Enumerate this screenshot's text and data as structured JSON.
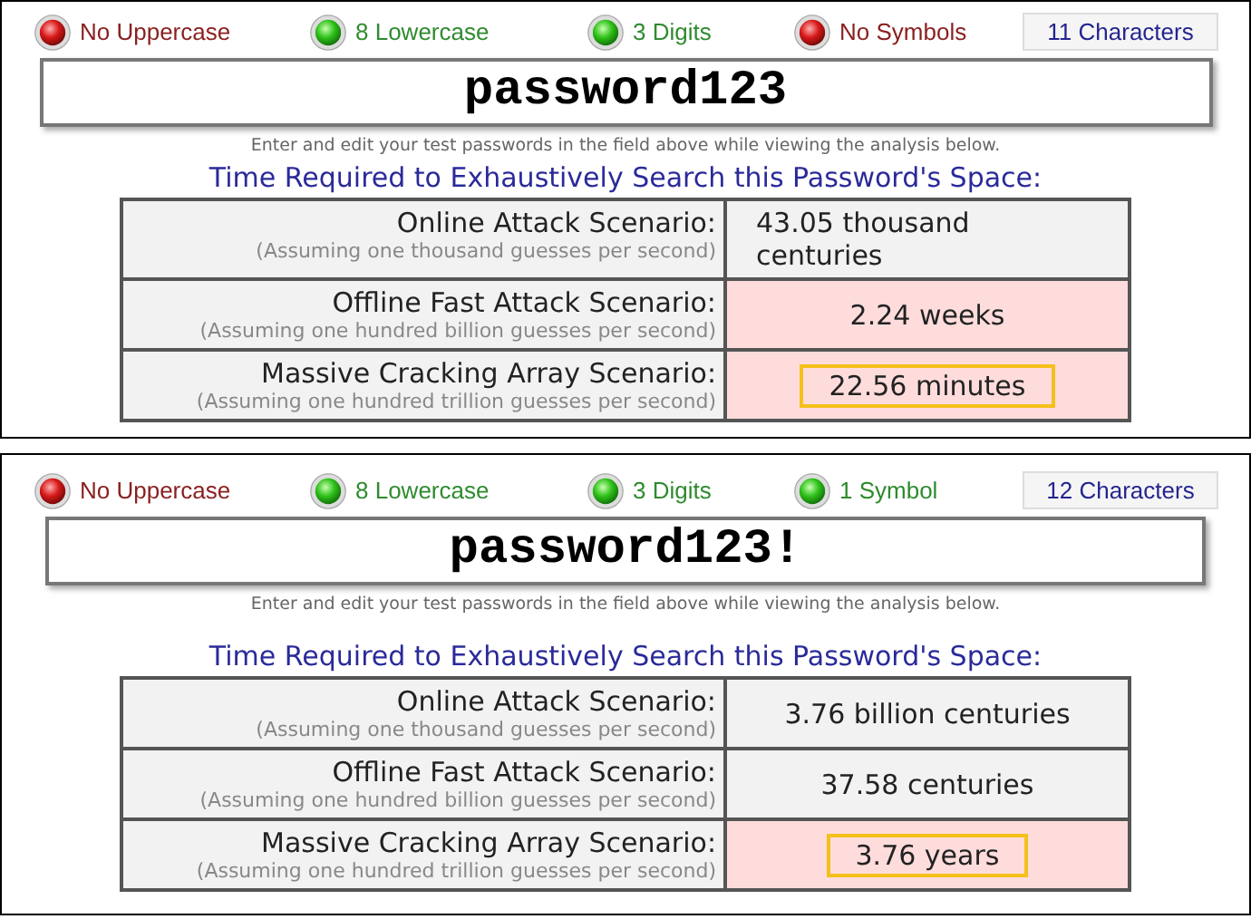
{
  "panels": [
    {
      "indicators": [
        {
          "label": "No Uppercase",
          "ok": false
        },
        {
          "label": "8 Lowercase",
          "ok": true
        },
        {
          "label": "3 Digits",
          "ok": true
        },
        {
          "label": "No Symbols",
          "ok": false
        }
      ],
      "length": "11 Characters",
      "password": "password123",
      "hint": "Enter and edit your test passwords in the field above while viewing the analysis below.",
      "title": "Time Required to Exhaustively Search this Password's Space:",
      "scenarios": [
        {
          "name": "Online Attack Scenario:",
          "assumption": "(Assuming one thousand guesses per second)",
          "time": "43.05 thousand centuries",
          "weak": false,
          "highlighted": false
        },
        {
          "name": "Offline Fast Attack Scenario:",
          "assumption": "(Assuming one hundred billion guesses per second)",
          "time": "2.24 weeks",
          "weak": true,
          "highlighted": false
        },
        {
          "name": "Massive Cracking Array Scenario:",
          "assumption": "(Assuming one hundred trillion guesses per second)",
          "time": "22.56 minutes",
          "weak": true,
          "highlighted": true
        }
      ]
    },
    {
      "indicators": [
        {
          "label": "No Uppercase",
          "ok": false
        },
        {
          "label": "8 Lowercase",
          "ok": true
        },
        {
          "label": "3 Digits",
          "ok": true
        },
        {
          "label": "1 Symbol",
          "ok": true
        }
      ],
      "length": "12 Characters",
      "password": "password123!",
      "hint": "Enter and edit your test passwords in the field above while viewing the analysis below.",
      "title": "Time Required to Exhaustively Search this Password's Space:",
      "scenarios": [
        {
          "name": "Online Attack Scenario:",
          "assumption": "(Assuming one thousand guesses per second)",
          "time": "3.76 billion centuries",
          "weak": false,
          "highlighted": false
        },
        {
          "name": "Offline Fast Attack Scenario:",
          "assumption": "(Assuming one hundred billion guesses per second)",
          "time": "37.58 centuries",
          "weak": false,
          "highlighted": false
        },
        {
          "name": "Massive Cracking Array Scenario:",
          "assumption": "(Assuming one hundred trillion guesses per second)",
          "time": "3.76 years",
          "weak": true,
          "highlighted": true
        }
      ]
    }
  ]
}
